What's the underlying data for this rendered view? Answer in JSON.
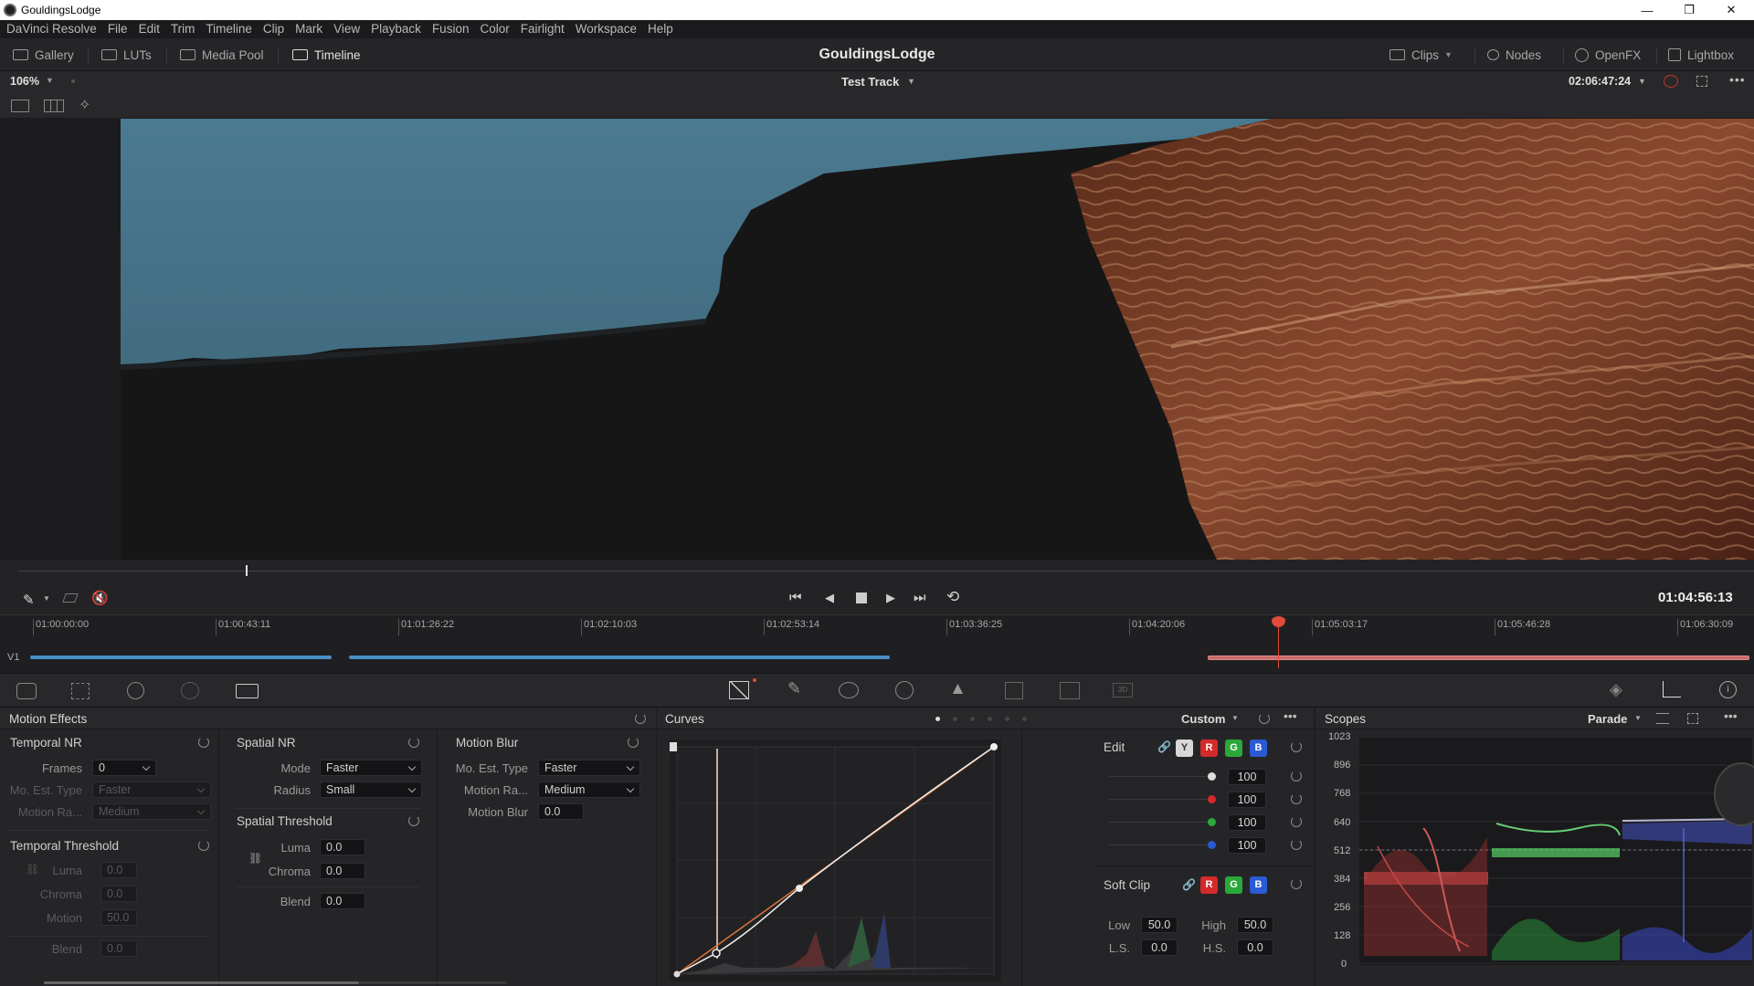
{
  "window": {
    "title": "GouldingsLodge",
    "minimize": "—",
    "restore": "❐",
    "close": "✕"
  },
  "menu": [
    "DaVinci Resolve",
    "File",
    "Edit",
    "Trim",
    "Timeline",
    "Clip",
    "Mark",
    "View",
    "Playback",
    "Fusion",
    "Color",
    "Fairlight",
    "Workspace",
    "Help"
  ],
  "toolbar": {
    "gallery": "Gallery",
    "luts": "LUTs",
    "media_pool": "Media Pool",
    "timeline": "Timeline",
    "project_title": "GouldingsLodge",
    "clips": "Clips",
    "nodes": "Nodes",
    "openfx": "OpenFX",
    "lightbox": "Lightbox"
  },
  "viewer": {
    "zoom": "106%",
    "track_name": "Test Track",
    "source_timecode": "02:06:47:24"
  },
  "transport": {
    "timecode": "01:04:56:13"
  },
  "timeline": {
    "track_label": "V1",
    "ruler": [
      "01:00:00:00",
      "01:00:43:11",
      "01:01:26:22",
      "01:02:10:03",
      "01:02:53:14",
      "01:03:36:25",
      "01:04:20:06",
      "01:05:03:17",
      "01:05:46:28",
      "01:06:30:09"
    ]
  },
  "motion_effects": {
    "title": "Motion Effects",
    "temporal_nr": {
      "title": "Temporal NR",
      "frames_label": "Frames",
      "frames_value": "0",
      "mo_est_type_label": "Mo. Est. Type",
      "mo_est_type_value": "Faster",
      "motion_range_label": "Motion Ra...",
      "motion_range_value": "Medium"
    },
    "temporal_threshold": {
      "title": "Temporal Threshold",
      "luma_label": "Luma",
      "luma_value": "0.0",
      "chroma_label": "Chroma",
      "chroma_value": "0.0",
      "motion_label": "Motion",
      "motion_value": "50.0",
      "blend_label": "Blend",
      "blend_value": "0.0"
    },
    "spatial_nr": {
      "title": "Spatial NR",
      "mode_label": "Mode",
      "mode_value": "Faster",
      "radius_label": "Radius",
      "radius_value": "Small"
    },
    "spatial_threshold": {
      "title": "Spatial Threshold",
      "luma_label": "Luma",
      "luma_value": "0.0",
      "chroma_label": "Chroma",
      "chroma_value": "0.0",
      "blend_label": "Blend",
      "blend_value": "0.0"
    },
    "motion_blur": {
      "title": "Motion Blur",
      "mo_est_type_label": "Mo. Est. Type",
      "mo_est_type_value": "Faster",
      "motion_range_label": "Motion Ra...",
      "motion_range_value": "Medium",
      "motion_blur_label": "Motion Blur",
      "motion_blur_value": "0.0"
    }
  },
  "curves": {
    "title": "Curves",
    "mode": "Custom",
    "edit_label": "Edit",
    "channels": [
      "Y",
      "R",
      "G",
      "B"
    ],
    "channel_colors": [
      "#d8d8d8",
      "#d42a2a",
      "#2aa83a",
      "#2a5ad4"
    ],
    "intensity_values": [
      "100",
      "100",
      "100",
      "100"
    ],
    "soft_clip_label": "Soft Clip",
    "low_label": "Low",
    "low_value": "50.0",
    "high_label": "High",
    "high_value": "50.0",
    "ls_label": "L.S.",
    "ls_value": "0.0",
    "hs_label": "H.S.",
    "hs_value": "0.0"
  },
  "scopes": {
    "title": "Scopes",
    "mode": "Parade",
    "scale": [
      "1023",
      "896",
      "768",
      "640",
      "512",
      "384",
      "256",
      "128",
      "0"
    ]
  }
}
